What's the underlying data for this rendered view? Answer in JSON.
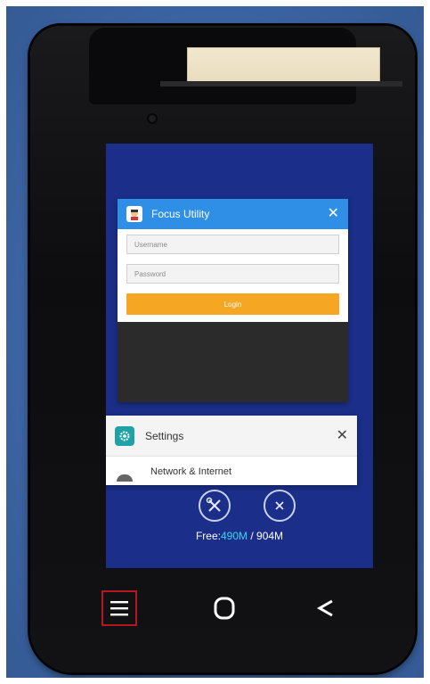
{
  "recents": {
    "focus_utility": {
      "title": "Focus Utility",
      "username_placeholder": "Username",
      "password_placeholder": "Password",
      "login_label": "Login",
      "close_glyph": "✕"
    },
    "settings": {
      "title": "Settings",
      "first_item": "Network & Internet",
      "close_glyph": "✕"
    },
    "actions": {
      "clean_icon": "wrench-screwdriver-icon",
      "clear_all_icon": "close-circle-icon"
    },
    "memory": {
      "prefix": "Free:",
      "free": "490M",
      "separator": " / ",
      "total": "904M"
    }
  },
  "navigation": {
    "menu_icon": "menu-icon",
    "home_icon": "home-icon",
    "back_icon": "back-icon"
  },
  "colors": {
    "focus_header": "#2f8fe6",
    "login_button": "#f5a623",
    "settings_icon": "#1fa1a8",
    "free_memory": "#34d7f0",
    "highlight_border": "#b4181e"
  }
}
